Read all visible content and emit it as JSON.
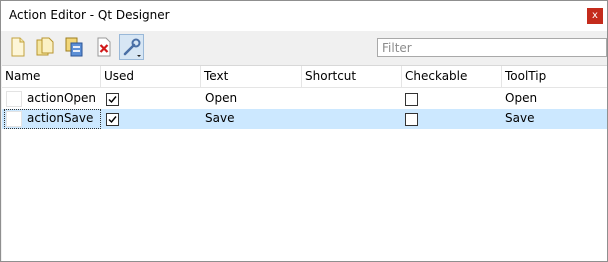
{
  "window": {
    "title": "Action Editor - Qt Designer",
    "close_label": "x"
  },
  "toolbar": {
    "tools": [
      {
        "name": "new-action",
        "icon": "new-document-icon"
      },
      {
        "name": "edit-action",
        "icon": "open-folder-icon"
      },
      {
        "name": "copy-action",
        "icon": "copy-icon"
      },
      {
        "name": "delete-action",
        "icon": "delete-icon"
      },
      {
        "name": "configure-action",
        "icon": "wrench-icon",
        "checked": true
      }
    ],
    "filter": {
      "value": "",
      "placeholder": "Filter"
    }
  },
  "table": {
    "columns": [
      "Name",
      "Used",
      "Text",
      "Shortcut",
      "Checkable",
      "ToolTip"
    ],
    "rows": [
      {
        "name": "actionOpen",
        "used": true,
        "text": "Open",
        "shortcut": "",
        "checkable": false,
        "tooltip": "Open",
        "selected": false
      },
      {
        "name": "actionSave",
        "used": true,
        "text": "Save",
        "shortcut": "",
        "checkable": false,
        "tooltip": "Save",
        "selected": true
      }
    ]
  },
  "colors": {
    "selection": "#cce8ff",
    "close_button": "#c42b1c",
    "tool_checked": "#d7e6f4"
  }
}
